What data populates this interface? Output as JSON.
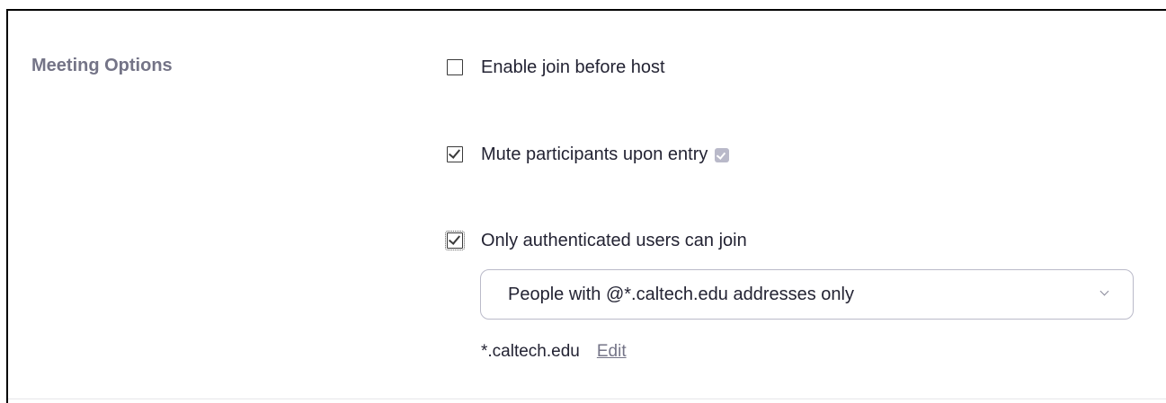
{
  "section": {
    "label": "Meeting Options"
  },
  "options": [
    {
      "label": "Enable join before host",
      "checked": false
    },
    {
      "label": "Mute participants upon entry",
      "checked": true,
      "icon": "locked-setting-icon"
    },
    {
      "label": "Only authenticated users can join",
      "checked": true
    }
  ],
  "auth": {
    "selected": "People with @*.caltech.edu addresses only",
    "domain": "*.caltech.edu",
    "edit_label": "Edit"
  },
  "colors": {
    "label_gray": "#747487",
    "text_dark": "#232333",
    "dropdown_border": "#babac9",
    "icon_badge": "#b9b9c9"
  }
}
